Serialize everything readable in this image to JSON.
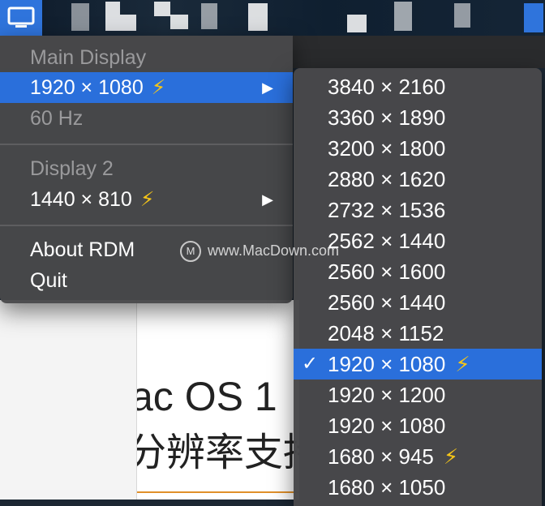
{
  "main_menu": {
    "main_display": {
      "header": "Main Display",
      "resolution": "1920 × 1080",
      "refresh": "60 Hz"
    },
    "display_2": {
      "header": "Display 2",
      "resolution": "1440 × 810"
    },
    "about": "About RDM",
    "quit": "Quit"
  },
  "icons": {
    "bolt": "⚡",
    "submenu_arrow": "▶",
    "checkmark": "✓"
  },
  "submenu": {
    "items": [
      {
        "label": "3840 × 2160",
        "hidpi": false,
        "selected": false
      },
      {
        "label": "3360 × 1890",
        "hidpi": false,
        "selected": false
      },
      {
        "label": "3200 × 1800",
        "hidpi": false,
        "selected": false
      },
      {
        "label": "2880 × 1620",
        "hidpi": false,
        "selected": false
      },
      {
        "label": "2732 × 1536",
        "hidpi": false,
        "selected": false
      },
      {
        "label": "2562 × 1440",
        "hidpi": false,
        "selected": false
      },
      {
        "label": "2560 × 1600",
        "hidpi": false,
        "selected": false
      },
      {
        "label": "2560 × 1440",
        "hidpi": false,
        "selected": false
      },
      {
        "label": "2048 × 1152",
        "hidpi": false,
        "selected": false
      },
      {
        "label": "1920 × 1080",
        "hidpi": true,
        "selected": true
      },
      {
        "label": "1920 × 1200",
        "hidpi": false,
        "selected": false
      },
      {
        "label": "1920 × 1080",
        "hidpi": false,
        "selected": false
      },
      {
        "label": "1680 × 945",
        "hidpi": true,
        "selected": false
      },
      {
        "label": "1680 × 1050",
        "hidpi": false,
        "selected": false
      }
    ]
  },
  "background": {
    "heading_line_1": "ac OS 1",
    "heading_line_2": "分辨率支持"
  },
  "watermark": {
    "text": "www.MacDown.com"
  },
  "colors": {
    "highlight": "#2a6fdb",
    "bolt": "#f5c518",
    "menu_bg": "#48484a",
    "disabled_text": "#9a9a9c",
    "menubar_icon_bg": "#2f74dc"
  }
}
